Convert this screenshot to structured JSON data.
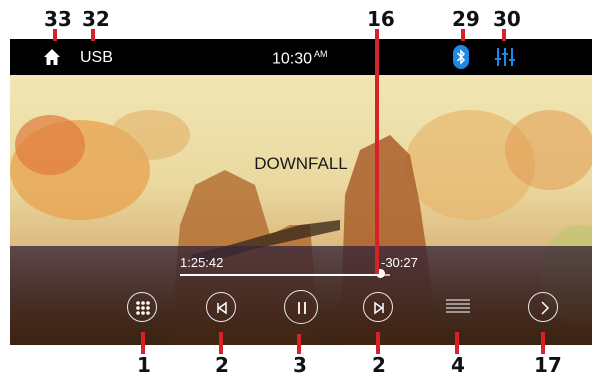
{
  "callouts": {
    "home": "33",
    "source": "32",
    "progress": "16",
    "bluetooth": "29",
    "equalizer": "30",
    "apps": "1",
    "prev": "2",
    "play_pause": "3",
    "next": "2",
    "list": "4",
    "more": "17"
  },
  "statusbar": {
    "source": "USB",
    "time": "10:30",
    "ampm": "AM"
  },
  "player": {
    "track_title": "DOWNFALL",
    "elapsed": "1:25:42",
    "remaining": "-30:27",
    "progress_fraction": 0.945
  },
  "colors": {
    "accent_bluetooth": "#1e88e5",
    "accent_equalizer": "#1e88e5",
    "callout_line": "#d8222a"
  },
  "icons": [
    "home-icon",
    "bluetooth-icon",
    "equalizer-icon",
    "apps-grid-icon",
    "previous-track-icon",
    "pause-icon",
    "next-track-icon",
    "list-icon",
    "chevron-right-icon"
  ]
}
